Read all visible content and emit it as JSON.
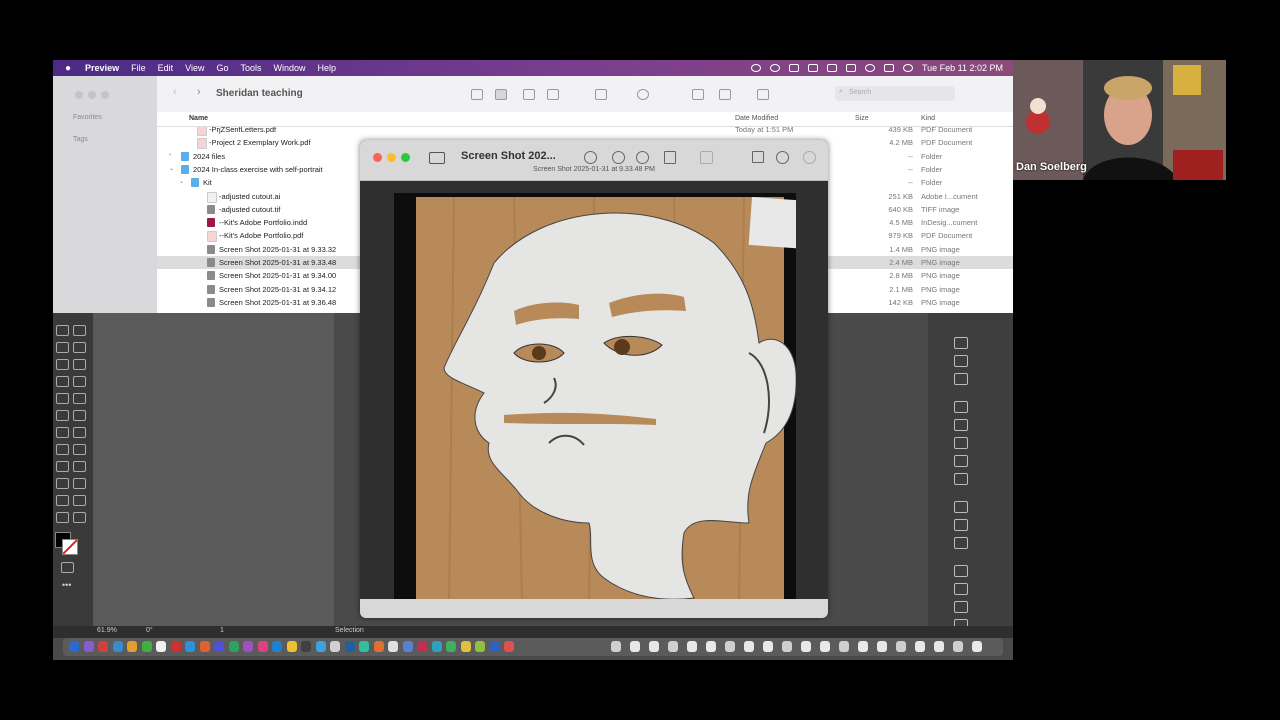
{
  "menubar": {
    "app": "Preview",
    "items": [
      "File",
      "Edit",
      "View",
      "Go",
      "Tools",
      "Window",
      "Help"
    ],
    "clock": "Tue Feb 11  2:02 PM"
  },
  "finder": {
    "title": "Sheridan teaching",
    "sidebar": {
      "favorites": "Favorites",
      "tags": "Tags"
    },
    "search_placeholder": "Search",
    "columns": {
      "name": "Name",
      "date": "Date Modified",
      "size": "Size",
      "kind": "Kind"
    },
    "rows": [
      {
        "name": "-PrjZSerifLetters.pdf",
        "date": "Today at 1:51 PM",
        "size": "439 KB",
        "kind": "PDF Document",
        "icon": "pdf"
      },
      {
        "name": "-Project 2 Exemplary Work.pdf",
        "date": "",
        "size": "4.2 MB",
        "kind": "PDF Document",
        "icon": "pdf"
      },
      {
        "name": "2024 files",
        "date": "",
        "size": "--",
        "kind": "Folder",
        "icon": "folder",
        "tri": ">"
      },
      {
        "name": "2024 In-class exercise with self-portrait",
        "date": "",
        "size": "--",
        "kind": "Folder",
        "icon": "folder",
        "tri": "v"
      },
      {
        "name": "Kit",
        "date": "",
        "size": "--",
        "kind": "Folder",
        "icon": "folder",
        "tri": "v"
      },
      {
        "name": "-adjusted cutout.ai",
        "date": "",
        "size": "251 KB",
        "kind": "Adobe I...cument",
        "icon": "doc"
      },
      {
        "name": "-adjusted cutout.tif",
        "date": "",
        "size": "640 KB",
        "kind": "TIFF image",
        "icon": "img"
      },
      {
        "name": "--Kit's Adobe Portfolio.indd",
        "date": "",
        "size": "4.5 MB",
        "kind": "InDesig...cument",
        "icon": "indd"
      },
      {
        "name": "--Kit's Adobe Portfolio.pdf",
        "date": "",
        "size": "979 KB",
        "kind": "PDF Document",
        "icon": "pdf"
      },
      {
        "name": "Screen Shot 2025-01-31 at 9.33.32",
        "date": "",
        "size": "1.4 MB",
        "kind": "PNG image",
        "icon": "img"
      },
      {
        "name": "Screen Shot 2025-01-31 at 9.33.48",
        "date": "",
        "size": "2.4 MB",
        "kind": "PNG image",
        "icon": "img"
      },
      {
        "name": "Screen Shot 2025-01-31 at 9.34.00",
        "date": "",
        "size": "2.8 MB",
        "kind": "PNG image",
        "icon": "img"
      },
      {
        "name": "Screen Shot 2025-01-31 at 9.34.12",
        "date": "",
        "size": "2.1 MB",
        "kind": "PNG image",
        "icon": "img"
      },
      {
        "name": "Screen Shot 2025-01-31 at 9.36.48",
        "date": "",
        "size": "142 KB",
        "kind": "PNG image",
        "icon": "img"
      }
    ],
    "selected_index": 10
  },
  "preview": {
    "title": "Screen Shot 202...",
    "subtitle": "Screen Shot 2025-01-31 at 9.33.48 PM"
  },
  "illustrator": {
    "zoom": "61.9%",
    "rotation": "0°",
    "artboard": "1",
    "tool": "Selection"
  },
  "webcam": {
    "name": "Dan Soelberg"
  }
}
